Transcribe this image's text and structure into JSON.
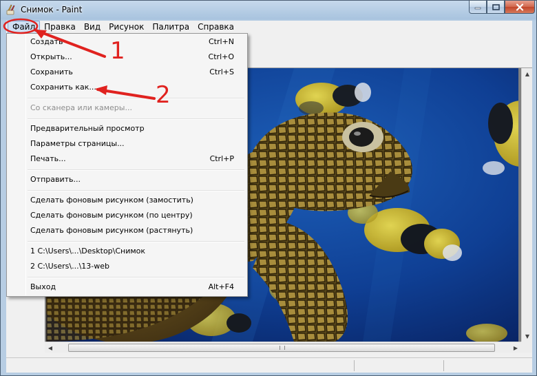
{
  "window": {
    "title": "Снимок - Paint"
  },
  "menubar": {
    "items": [
      {
        "label": "Файл",
        "active": true
      },
      {
        "label": "Правка"
      },
      {
        "label": "Вид"
      },
      {
        "label": "Рисунок"
      },
      {
        "label": "Палитра"
      },
      {
        "label": "Справка"
      }
    ]
  },
  "file_menu": {
    "create": {
      "label": "Создать",
      "shortcut": "Ctrl+N"
    },
    "open": {
      "label": "Открыть...",
      "shortcut": "Ctrl+O"
    },
    "save": {
      "label": "Сохранить",
      "shortcut": "Ctrl+S"
    },
    "save_as": {
      "label": "Сохранить как..."
    },
    "from_scanner": {
      "label": "Со сканера или камеры..."
    },
    "print_preview": {
      "label": "Предварительный просмотр"
    },
    "page_setup": {
      "label": "Параметры страницы..."
    },
    "print": {
      "label": "Печать...",
      "shortcut": "Ctrl+P"
    },
    "send": {
      "label": "Отправить..."
    },
    "wallpaper_tile": {
      "label": "Сделать фоновым рисунком (замостить)"
    },
    "wallpaper_center": {
      "label": "Сделать фоновым рисунком (по центру)"
    },
    "wallpaper_stretch": {
      "label": "Сделать фоновым рисунком (растянуть)"
    },
    "recent_1": {
      "label": "1 C:\\Users\\...\\Desktop\\Снимок"
    },
    "recent_2": {
      "label": "2 C:\\Users\\...\\13-web"
    },
    "exit": {
      "label": "Выход",
      "shortcut": "Alt+F4"
    }
  },
  "annotations": {
    "marker_1": "1",
    "marker_2": "2"
  },
  "colors": {
    "annotation_red": "#e0221f",
    "menu_highlight": "#cfe0f3",
    "close_button": "#c2452a"
  }
}
